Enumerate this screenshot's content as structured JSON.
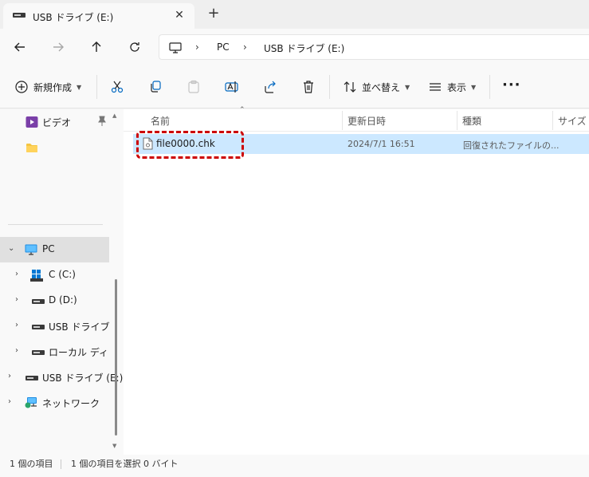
{
  "window": {
    "tab_title": "USB ドライブ (E:)",
    "tab_close": "✕",
    "new_tab": "+"
  },
  "address": {
    "separator": "›",
    "crumbs": [
      "PC",
      "USB ドライブ (E:)"
    ]
  },
  "commands": {
    "new_label": "新規作成",
    "sort_label": "並べ替え",
    "view_label": "表示",
    "more": "···"
  },
  "sidebar": {
    "quick_items": [
      {
        "label": "ビデオ",
        "icon": "video-icon",
        "pinned": true
      },
      {
        "label": "",
        "icon": "folder-icon",
        "pinned": false
      }
    ],
    "pc_label": "PC",
    "drives": [
      {
        "label": "C (C:)",
        "icon": "windows-drive-icon"
      },
      {
        "label": "D (D:)",
        "icon": "drive-icon"
      },
      {
        "label": "USB ドライブ (E:)",
        "icon": "drive-icon"
      },
      {
        "label": "ローカル ディスク",
        "icon": "drive-icon"
      }
    ],
    "usb_root_label": "USB ドライブ (E:)",
    "network_label": "ネットワーク"
  },
  "columns": {
    "name": "名前",
    "modified": "更新日時",
    "type": "種類",
    "size": "サイズ"
  },
  "files": [
    {
      "name": "file0000.chk",
      "modified": "2024/7/1 16:51",
      "type": "回復されたファイルの...",
      "selected": true
    }
  ],
  "status": {
    "count": "1 個の項目",
    "selection": "1 個の項目を選択  0 バイト"
  },
  "colors": {
    "selection": "#cce8ff",
    "highlight_border": "#cc0000",
    "sidebar_selected": "#e0e0e0"
  }
}
